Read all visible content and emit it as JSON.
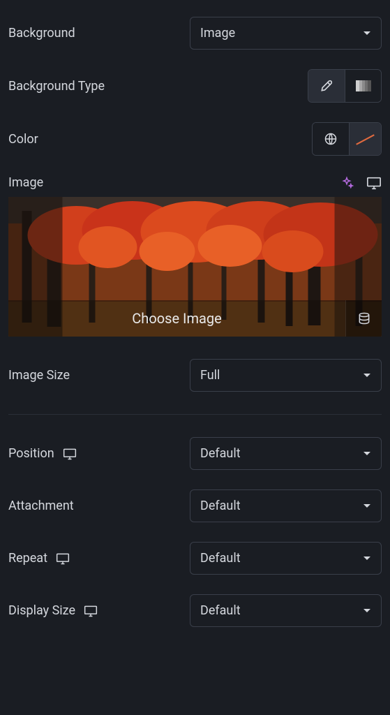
{
  "background": {
    "label": "Background",
    "value": "Image"
  },
  "background_type": {
    "label": "Background Type"
  },
  "color": {
    "label": "Color"
  },
  "image": {
    "label": "Image",
    "choose_label": "Choose Image"
  },
  "image_size": {
    "label": "Image Size",
    "value": "Full"
  },
  "position": {
    "label": "Position",
    "value": "Default"
  },
  "attachment": {
    "label": "Attachment",
    "value": "Default"
  },
  "repeat": {
    "label": "Repeat",
    "value": "Default"
  },
  "display_size": {
    "label": "Display Size",
    "value": "Default"
  }
}
